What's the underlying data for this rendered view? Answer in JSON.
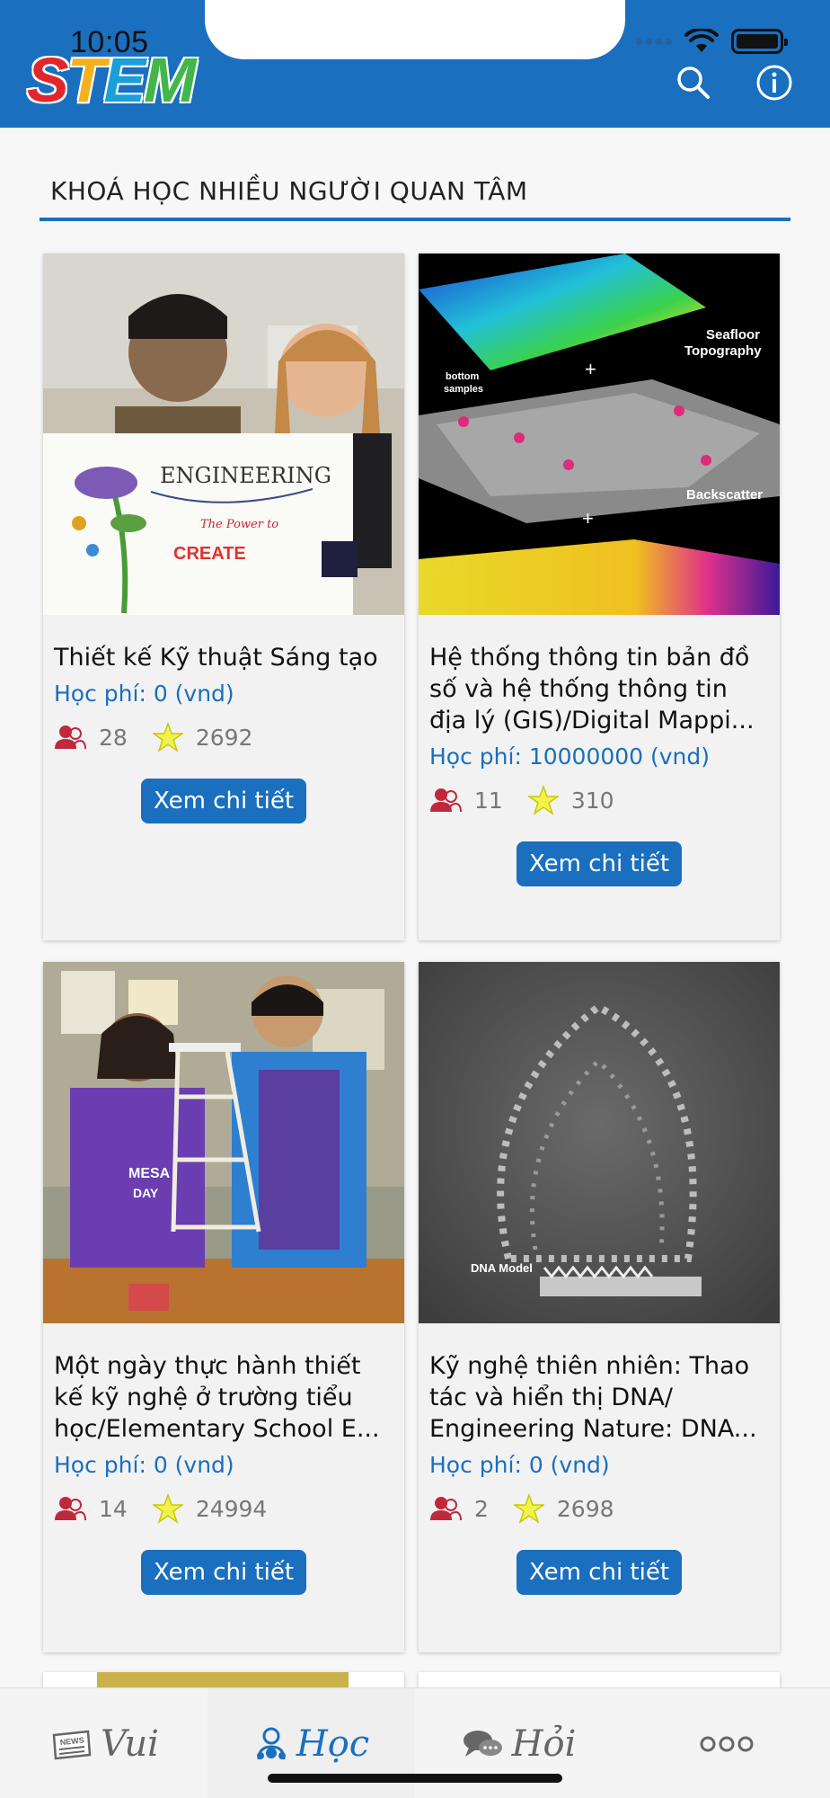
{
  "status_bar": {
    "time": "10:05"
  },
  "header": {
    "logo_letters": [
      {
        "ch": "S",
        "color": "#e2262c"
      },
      {
        "ch": "T",
        "color": "#f6b01b"
      },
      {
        "ch": "E",
        "color": "#1a9fd9"
      },
      {
        "ch": "M",
        "color": "#43b649"
      }
    ],
    "icons": [
      "search-icon",
      "info-icon"
    ]
  },
  "section": {
    "title": "KHOÁ HỌC NHIỀU NGƯỜI QUAN TÂM"
  },
  "courses": [
    {
      "title": "Thiết kế Kỹ thuật Sáng tạo",
      "price": "Học phí: 0 (vnd)",
      "learners": "28",
      "rating": "2692",
      "button": "Xem chi tiết",
      "image_text": [
        "ENGINEERING",
        "The Power to",
        "CREATE"
      ]
    },
    {
      "title": "Hệ thống thông tin bản đồ số và hệ thống thông tin địa lý (GIS)/Digital Mappi...",
      "price": "Học phí: 10000000 (vnd)",
      "learners": "11",
      "rating": "310",
      "button": "Xem chi tiết",
      "image_text": [
        "Seafloor",
        "Topography",
        "bottom",
        "samples",
        "Backscatter",
        "+",
        "+"
      ]
    },
    {
      "title": "Một ngày thực hành thiết kế kỹ nghệ ở trường tiểu học/Elementary School E...",
      "price": "Học phí: 0 (vnd)",
      "learners": "14",
      "rating": "24994",
      "button": "Xem chi tiết",
      "image_text": [
        "MESA",
        "DAY"
      ]
    },
    {
      "title": "Kỹ nghệ thiên nhiên: Thao tác và hiển thị DNA/ Engineering Nature: DNA...",
      "price": "Học phí: 0 (vnd)",
      "learners": "2",
      "rating": "2698",
      "button": "Xem chi tiết",
      "image_text": [
        "DNA Model"
      ]
    }
  ],
  "bottom_nav": [
    {
      "label": "Vui",
      "icon": "news-icon",
      "active": false
    },
    {
      "label": "Học",
      "icon": "learn-icon",
      "active": true
    },
    {
      "label": "Hỏi",
      "icon": "chat-icon",
      "active": false
    },
    {
      "label": "",
      "icon": "more-icon",
      "active": false
    }
  ],
  "colors": {
    "primary": "#1a6fbf",
    "stat_icon": "#c0283c",
    "star": "#e8e820"
  }
}
